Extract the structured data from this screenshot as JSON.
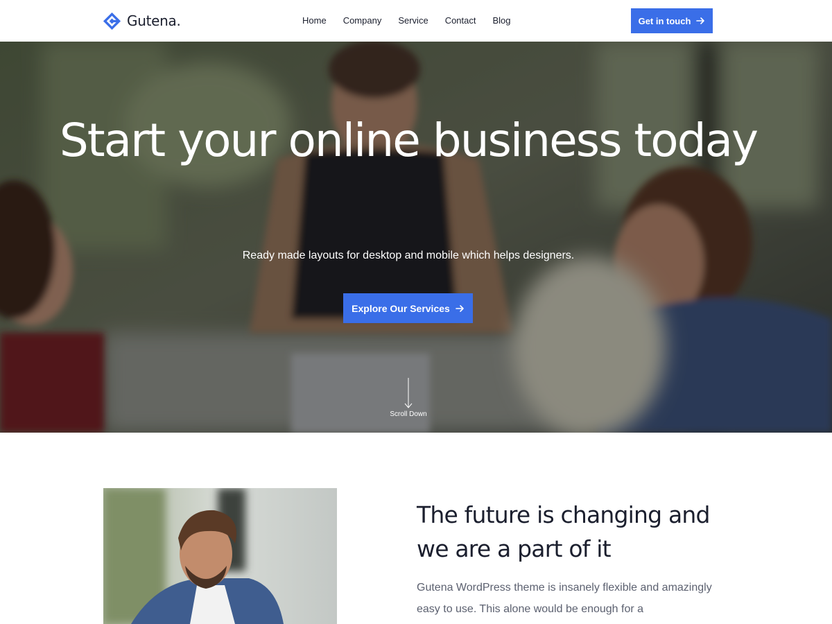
{
  "brand": {
    "name": "Gutena.",
    "accent_color": "#3a6ee8"
  },
  "nav": {
    "items": [
      {
        "label": "Home"
      },
      {
        "label": "Company"
      },
      {
        "label": "Service"
      },
      {
        "label": "Contact"
      },
      {
        "label": "Blog"
      }
    ],
    "cta_label": "Get in touch",
    "cta_icon": "arrow-right-icon"
  },
  "hero": {
    "title": "Start your online business today",
    "subtitle": "Ready made layouts for desktop and mobile which helps designers.",
    "button_label": "Explore Our Services",
    "button_icon": "arrow-right-icon",
    "scroll_label": "Scroll Down",
    "scroll_icon": "arrow-down-icon",
    "image": "business-meeting-photo"
  },
  "about": {
    "heading": "The future is changing and we are a part of it",
    "body": "Gutena WordPress theme is insanely flexible and amazingly easy to use. This alone would be enough for a",
    "image": "smiling-man-photo"
  }
}
